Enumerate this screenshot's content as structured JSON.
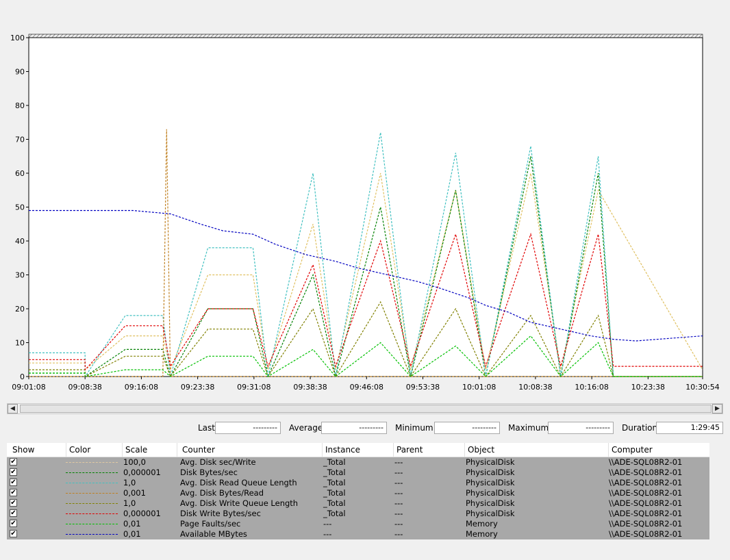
{
  "chart_data": {
    "type": "line",
    "ylim": [
      0,
      100
    ],
    "yticks": [
      "0",
      "10",
      "20",
      "30",
      "40",
      "50",
      "60",
      "70",
      "80",
      "90",
      "100"
    ],
    "xticks": [
      "09:01:08",
      "09:08:38",
      "09:16:08",
      "09:23:38",
      "09:31:08",
      "09:38:38",
      "09:46:08",
      "09:53:38",
      "10:01:08",
      "10:08:38",
      "10:16:08",
      "10:23:38",
      "10:30:54"
    ],
    "x_range": [
      "09:01:08",
      "10:30:54"
    ],
    "grid": false,
    "series": [
      {
        "name": "Avg. Disk sec/Write",
        "color": "#e0c060",
        "style": "dashed",
        "x": [
          "09:01:08",
          "09:08:38",
          "09:08:39",
          "09:14:00",
          "09:19:00",
          "09:20:00",
          "09:25:00",
          "09:31:00",
          "09:33:00",
          "09:39:00",
          "09:42:00",
          "09:48:00",
          "09:52:00",
          "09:58:00",
          "10:02:00",
          "10:08:00",
          "10:12:00",
          "10:17:00",
          "10:30:54"
        ],
        "y": [
          4,
          4,
          2,
          12,
          12,
          2,
          30,
          30,
          2,
          45,
          2,
          60,
          2,
          55,
          2,
          60,
          2,
          55,
          2
        ]
      },
      {
        "name": "Disk Bytes/sec",
        "color": "#008000",
        "style": "dashed",
        "x": [
          "09:01:08",
          "09:08:38",
          "09:08:39",
          "09:14:00",
          "09:19:00",
          "09:20:00",
          "09:25:00",
          "09:31:00",
          "09:33:00",
          "09:39:00",
          "09:42:00",
          "09:48:00",
          "09:52:00",
          "09:58:00",
          "10:02:00",
          "10:08:00",
          "10:12:00",
          "10:17:00",
          "10:19:00",
          "10:30:54"
        ],
        "y": [
          1,
          1,
          0,
          8,
          8,
          0,
          20,
          20,
          0,
          30,
          0,
          50,
          0,
          55,
          0,
          65,
          0,
          60,
          0,
          0
        ]
      },
      {
        "name": "Avg. Disk Read Queue Length",
        "color": "#40c0c0",
        "style": "dashed",
        "x": [
          "09:01:08",
          "09:08:38",
          "09:08:39",
          "09:14:00",
          "09:19:00",
          "09:20:00",
          "09:25:00",
          "09:31:00",
          "09:33:00",
          "09:39:00",
          "09:42:00",
          "09:48:00",
          "09:52:00",
          "09:58:00",
          "10:02:00",
          "10:08:00",
          "10:12:00",
          "10:17:00",
          "10:19:00",
          "10:30:54"
        ],
        "y": [
          7,
          7,
          0,
          18,
          18,
          0,
          38,
          38,
          0,
          60,
          0,
          72,
          0,
          66,
          0,
          68,
          0,
          65,
          0,
          0
        ]
      },
      {
        "name": "Avg. Disk Bytes/Read",
        "color": "#c08020",
        "style": "dashed",
        "x": [
          "09:01:08",
          "09:19:00",
          "09:19:30",
          "09:20:00",
          "10:30:54"
        ],
        "y": [
          0,
          0,
          73,
          0,
          0
        ]
      },
      {
        "name": "Avg. Disk Write Queue Length",
        "color": "#808000",
        "style": "dashed",
        "x": [
          "09:01:08",
          "09:08:38",
          "09:08:39",
          "09:14:00",
          "09:19:00",
          "09:20:00",
          "09:25:00",
          "09:31:00",
          "09:33:00",
          "09:39:00",
          "09:42:00",
          "09:48:00",
          "09:52:00",
          "09:58:00",
          "10:02:00",
          "10:08:00",
          "10:12:00",
          "10:17:00",
          "10:19:00",
          "10:30:54"
        ],
        "y": [
          2,
          2,
          0,
          6,
          6,
          0,
          14,
          14,
          0,
          20,
          0,
          22,
          0,
          20,
          0,
          18,
          0,
          18,
          0,
          0
        ]
      },
      {
        "name": "Disk Write Bytes/sec",
        "color": "#e00000",
        "style": "dashed",
        "x": [
          "09:01:08",
          "09:08:38",
          "09:08:39",
          "09:14:00",
          "09:19:00",
          "09:20:00",
          "09:25:00",
          "09:31:00",
          "09:33:00",
          "09:39:00",
          "09:42:00",
          "09:48:00",
          "09:52:00",
          "09:58:00",
          "10:02:00",
          "10:08:00",
          "10:12:00",
          "10:17:00",
          "10:19:00",
          "10:30:54"
        ],
        "y": [
          5,
          5,
          2,
          15,
          15,
          3,
          20,
          20,
          3,
          33,
          3,
          40,
          3,
          42,
          3,
          42,
          3,
          42,
          3,
          3
        ]
      },
      {
        "name": "Page Faults/sec",
        "color": "#00c000",
        "style": "dashed",
        "x": [
          "09:01:08",
          "09:08:38",
          "09:08:39",
          "09:14:00",
          "09:19:00",
          "09:20:00",
          "09:25:00",
          "09:31:00",
          "09:33:00",
          "09:39:00",
          "09:42:00",
          "09:48:00",
          "09:52:00",
          "09:58:00",
          "10:02:00",
          "10:08:00",
          "10:12:00",
          "10:17:00",
          "10:19:00",
          "10:30:54"
        ],
        "y": [
          1,
          1,
          0,
          2,
          2,
          0,
          6,
          6,
          0,
          8,
          0,
          10,
          0,
          9,
          0,
          12,
          0,
          10,
          0,
          0
        ]
      },
      {
        "name": "Available MBytes",
        "color": "#0000c0",
        "style": "dashed",
        "x": [
          "09:01:08",
          "09:02:00",
          "09:15:00",
          "09:20:00",
          "09:24:00",
          "09:27:00",
          "09:31:00",
          "09:34:00",
          "09:38:00",
          "09:42:00",
          "09:45:00",
          "09:49:00",
          "09:53:00",
          "09:56:00",
          "10:00:00",
          "10:02:00",
          "10:05:00",
          "10:08:00",
          "10:12:00",
          "10:16:00",
          "10:19:00",
          "10:22:00",
          "10:30:54"
        ],
        "y": [
          49,
          49,
          49,
          48,
          45,
          43,
          42,
          39,
          36,
          34,
          32,
          30,
          28,
          26,
          23,
          21,
          19,
          16,
          14,
          12,
          11,
          10.5,
          12
        ]
      }
    ]
  },
  "stats": {
    "last_label": "Last",
    "last_value": "---------",
    "average_label": "Average",
    "average_value": "---------",
    "minimum_label": "Minimum",
    "minimum_value": "---------",
    "maximum_label": "Maximum",
    "maximum_value": "---------",
    "duration_label": "Duration",
    "duration_value": "1:29:45"
  },
  "legend": {
    "headers": {
      "show": "Show",
      "color": "Color",
      "scale": "Scale",
      "counter": "Counter",
      "instance": "Instance",
      "parent": "Parent",
      "object": "Object",
      "computer": "Computer"
    },
    "rows": [
      {
        "color": "#e0c8a0",
        "scale": "100,0",
        "counter": "Avg. Disk sec/Write",
        "instance": "_Total",
        "parent": "---",
        "object": "PhysicalDisk",
        "computer": "\\\\ADE-SQL08R2-01"
      },
      {
        "color": "#008000",
        "scale": "0,000001",
        "counter": "Disk Bytes/sec",
        "instance": "_Total",
        "parent": "---",
        "object": "PhysicalDisk",
        "computer": "\\\\ADE-SQL08R2-01"
      },
      {
        "color": "#40c0c0",
        "scale": "1,0",
        "counter": "Avg. Disk Read Queue Length",
        "instance": "_Total",
        "parent": "---",
        "object": "PhysicalDisk",
        "computer": "\\\\ADE-SQL08R2-01"
      },
      {
        "color": "#c08020",
        "scale": "0,001",
        "counter": "Avg. Disk Bytes/Read",
        "instance": "_Total",
        "parent": "---",
        "object": "PhysicalDisk",
        "computer": "\\\\ADE-SQL08R2-01"
      },
      {
        "color": "#808000",
        "scale": "1,0",
        "counter": "Avg. Disk Write Queue Length",
        "instance": "_Total",
        "parent": "---",
        "object": "PhysicalDisk",
        "computer": "\\\\ADE-SQL08R2-01"
      },
      {
        "color": "#e00000",
        "scale": "0,000001",
        "counter": "Disk Write Bytes/sec",
        "instance": "_Total",
        "parent": "---",
        "object": "PhysicalDisk",
        "computer": "\\\\ADE-SQL08R2-01"
      },
      {
        "color": "#00c000",
        "scale": "0,01",
        "counter": "Page Faults/sec",
        "instance": "---",
        "parent": "---",
        "object": "Memory",
        "computer": "\\\\ADE-SQL08R2-01"
      },
      {
        "color": "#0000c0",
        "scale": "0,01",
        "counter": "Available MBytes",
        "instance": "---",
        "parent": "---",
        "object": "Memory",
        "computer": "\\\\ADE-SQL08R2-01"
      }
    ]
  }
}
